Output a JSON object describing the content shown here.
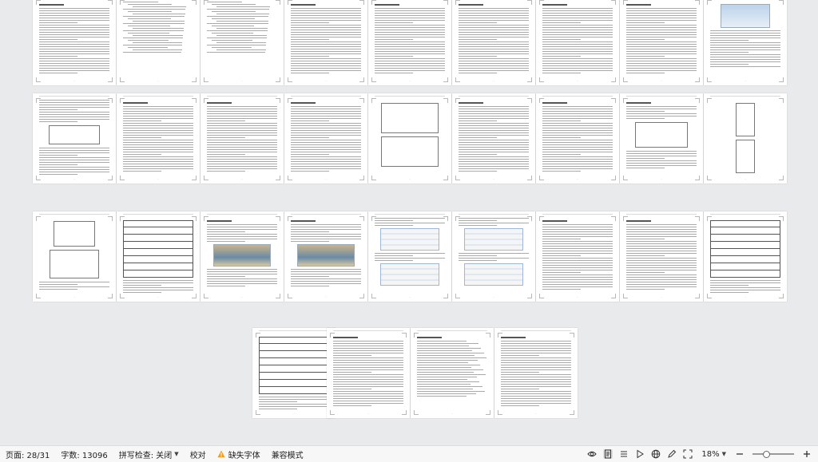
{
  "status_bar": {
    "page_info": "页面: 28/31",
    "word_count": "字数: 13096",
    "spell_check": "拼写检查: 关闭",
    "proofread": "校对",
    "missing_fonts": "缺失字体",
    "compat_mode": "兼容模式",
    "zoom_label": "18%",
    "zoom_level_percent": 18,
    "icons": [
      "eye-icon",
      "page-view-icon",
      "list-icon",
      "play-icon",
      "globe-icon",
      "pen-icon",
      "fit-page-icon",
      "zoom-out-icon",
      "zoom-in-icon"
    ]
  },
  "colors": {
    "workspace": "#e9eaec",
    "status_bar": "#f7f7f7",
    "warning": "#f0a020"
  },
  "document": {
    "total_pages": 31,
    "current_page": 28
  }
}
